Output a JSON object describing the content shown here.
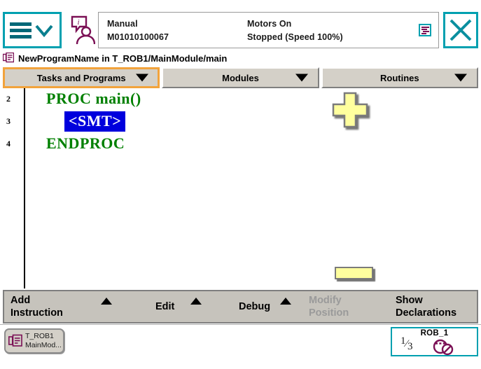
{
  "header": {
    "menu_button": "menu",
    "operator_icon": "operator-info-icon",
    "mode": "Manual",
    "controller_id": "M01010100067",
    "motors_state": "Motors On",
    "run_state": "Stopped (Speed 100%)",
    "task_icon": "program-task-icon",
    "close_label": "close"
  },
  "pathbar": {
    "icon": "program-module-icon",
    "program_name": "NewProgramName",
    "separator": "in",
    "path": "T_ROB1/MainModule/main",
    "full_text": "NewProgramName in T_ROB1/MainModule/main"
  },
  "tabs": [
    {
      "label": "Tasks and Programs",
      "selected": true
    },
    {
      "label": "Modules",
      "selected": false
    },
    {
      "label": "Routines",
      "selected": false
    }
  ],
  "editor": {
    "lines": [
      {
        "number": "2",
        "text": "PROC main()",
        "indent": 36,
        "selected": false
      },
      {
        "number": "3",
        "text": "<SMT>",
        "indent": 68,
        "selected": true
      },
      {
        "number": "4",
        "text": "ENDPROC",
        "indent": 36,
        "selected": false
      }
    ],
    "scroll_pad_icon": "scroll-pad-cross-icon",
    "scroll_bar_icon": "scroll-bar-handle"
  },
  "actionbar": [
    {
      "label_line1": "Add",
      "label_line2": "Instruction",
      "has_caret": true,
      "disabled": false
    },
    {
      "label_line1": "Edit",
      "label_line2": "",
      "has_caret": true,
      "disabled": false
    },
    {
      "label_line1": "Debug",
      "label_line2": "",
      "has_caret": true,
      "disabled": false
    },
    {
      "label_line1": "Modify",
      "label_line2": "Position",
      "has_caret": false,
      "disabled": true
    },
    {
      "label_line1": "Show",
      "label_line2": "Declarations",
      "has_caret": false,
      "disabled": false
    }
  ],
  "taskbar": {
    "button_icon": "program-module-icon",
    "button_line1": "T_ROB1",
    "button_line2": "MainMod...",
    "jog_title": "ROB_1",
    "jog_numerator": "1",
    "jog_denominator": "3",
    "jog_icon": "jog-disabled-icon"
  },
  "colors": {
    "accent_teal": "#00a0b0",
    "accent_teal_dark": "#006878",
    "icon_maroon": "#7b1055",
    "highlight_orange": "#f2a33c",
    "code_green": "#008000",
    "selection_blue": "#0000dd",
    "toolbar_gray": "#c6c3bc",
    "button_face": "#d4d0c8",
    "pad_yellow": "#ffff9e",
    "disabled_gray": "#9a9a9a"
  }
}
